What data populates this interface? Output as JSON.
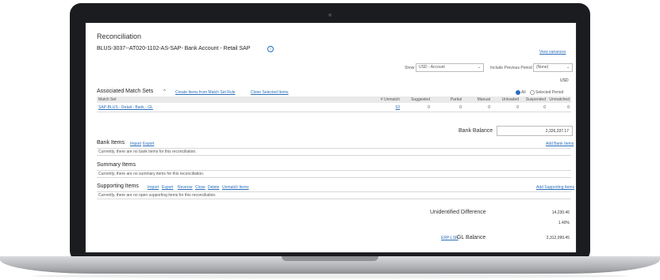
{
  "app": {
    "title": "Reconciliation",
    "account_title": "BLUS-3037--AT020-1102-AS-SAP- Bank Account - Retail SAP",
    "view_link": "View variances"
  },
  "filters": {
    "show_label": "Show",
    "show_value": "USD - Account",
    "period_label": "Include Previous Period",
    "period_value": "(None)",
    "currency": "USD"
  },
  "match_sets": {
    "label": "Associated Match Sets",
    "actions": [
      "Create Items from Match Set Rule",
      "Clone Selected Items"
    ],
    "radio_all": "All",
    "radio_selected": "Selected Period",
    "columns": [
      "Match Set",
      "# Unmatch",
      "Suggested",
      "Partial",
      "Manual",
      "Unloaded",
      "Suspended",
      "Unmatched"
    ],
    "rows": [
      {
        "name": "SAP-BLUS - Retail - Bank - GL",
        "cells": [
          "53",
          "0",
          "0",
          "0",
          "0",
          "0",
          "0"
        ]
      }
    ]
  },
  "bank_balance": {
    "label": "Bank Balance",
    "value": "2,326,337.17"
  },
  "bank_items": {
    "title": "Bank Items",
    "actions": [
      "Import",
      "Export"
    ],
    "add_link": "Add Bank Items",
    "empty": "Currently, there are no bank items for this reconciliation."
  },
  "summary_items": {
    "title": "Summary Items",
    "empty": "Currently, there are no summary items for this reconciliation."
  },
  "supporting_items": {
    "title": "Supporting Items",
    "actions": [
      "Import",
      "Export",
      "Reverse",
      "Close",
      "Delete",
      "Unmatch Items"
    ],
    "add_link": "Add Supporting Items",
    "empty": "Currently, there are no open supporting items for this reconciliation."
  },
  "unidentified": {
    "label": "Unidentified Difference",
    "value": "14,230.46",
    "percent": "1.40%"
  },
  "gl_balance": {
    "link": "ERP-LSR",
    "label": "GL Balance",
    "value": "2,312,099.45"
  }
}
